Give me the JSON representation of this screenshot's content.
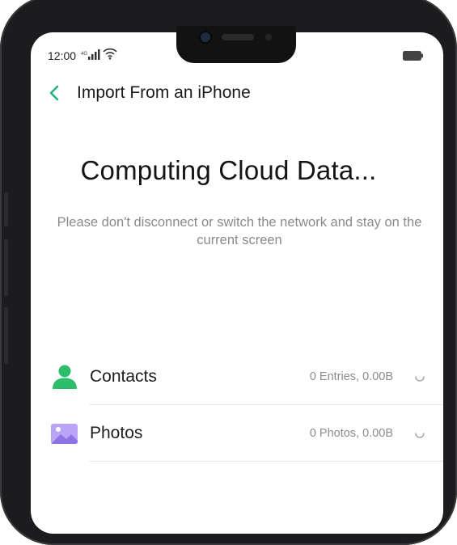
{
  "status_bar": {
    "time": "12:00",
    "signal_icon": "signal-icon",
    "wifi_icon": "wifi-icon",
    "battery_icon": "battery-icon"
  },
  "header": {
    "back_icon": "chevron-left-icon",
    "title": "Import From an iPhone"
  },
  "main": {
    "headline": "Computing Cloud Data...",
    "subtext": "Please don't disconnect or switch the network and stay on the current screen",
    "items": [
      {
        "label": "Contacts",
        "meta": "0 Entries, 0.00B",
        "icon": "person-icon",
        "color": "#2bbd6a"
      },
      {
        "label": "Photos",
        "meta": "0 Photos, 0.00B",
        "icon": "photo-icon",
        "color": "#a58cf0"
      }
    ]
  },
  "colors": {
    "accent": "#22b573",
    "phone_frame": "#1c1c1e"
  }
}
